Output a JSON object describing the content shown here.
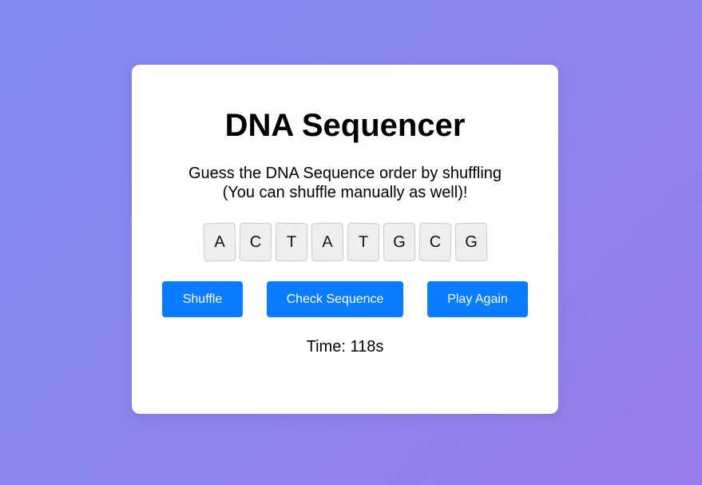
{
  "game": {
    "title": "DNA Sequencer",
    "instructions_line1": "Guess the DNA Sequence order by shuffling",
    "instructions_line2": "(You can shuffle manually as well)!",
    "tiles": [
      "A",
      "C",
      "T",
      "A",
      "T",
      "G",
      "C",
      "G"
    ],
    "buttons": {
      "shuffle": "Shuffle",
      "check": "Check Sequence",
      "play_again": "Play Again"
    },
    "timer": "Time: 118s"
  },
  "colors": {
    "background_start": "#7f8af3",
    "background_end": "#9a7ce8",
    "card": "#ffffff",
    "button": "#0a7cff",
    "tile": "#eeeeee"
  }
}
